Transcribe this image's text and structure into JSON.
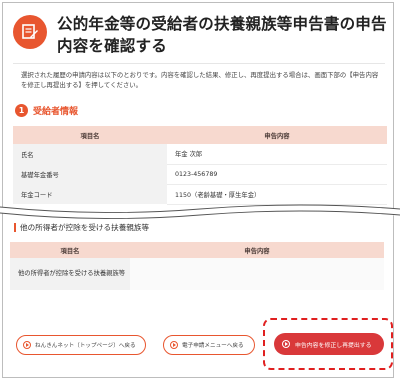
{
  "header": {
    "icon": "form-check-icon",
    "title": "公的年金等の受給者の扶養親族等申告書の申告内容を確認する",
    "accent": "#e8562f"
  },
  "intro": "選択された履歴の申請内容は以下のとおりです。内容を確認した結果、修正し、再度提出する場合は、画面下部の【申告内容を修正し再提出する】を押してください。",
  "section1": {
    "number": "1",
    "title": "受給者情報",
    "columns": [
      "項目名",
      "申告内容"
    ],
    "rows": [
      {
        "label": "氏名",
        "value": "年金 次郎"
      },
      {
        "label": "基礎年金番号",
        "value": "0123-456789"
      },
      {
        "label": "年金コード",
        "value": "1150（老齢基礎・厚生年金）"
      }
    ]
  },
  "section2": {
    "title": "他の所得者が控除を受ける扶養親族等",
    "columns": [
      "項目名",
      "申告内容"
    ],
    "rows": [
      {
        "label": "他の所得者が控除を受ける扶養親族等",
        "value": ""
      }
    ]
  },
  "buttons": {
    "top": "ねんきんネット（トップページ）へ戻る",
    "menu": "電子申請メニューへ戻る",
    "resubmit": "申告内容を修正し再提出する"
  },
  "colors": {
    "table_header": "#f7d9cf",
    "highlight_dash": "#e02020",
    "primary_button": "#d9383a"
  }
}
